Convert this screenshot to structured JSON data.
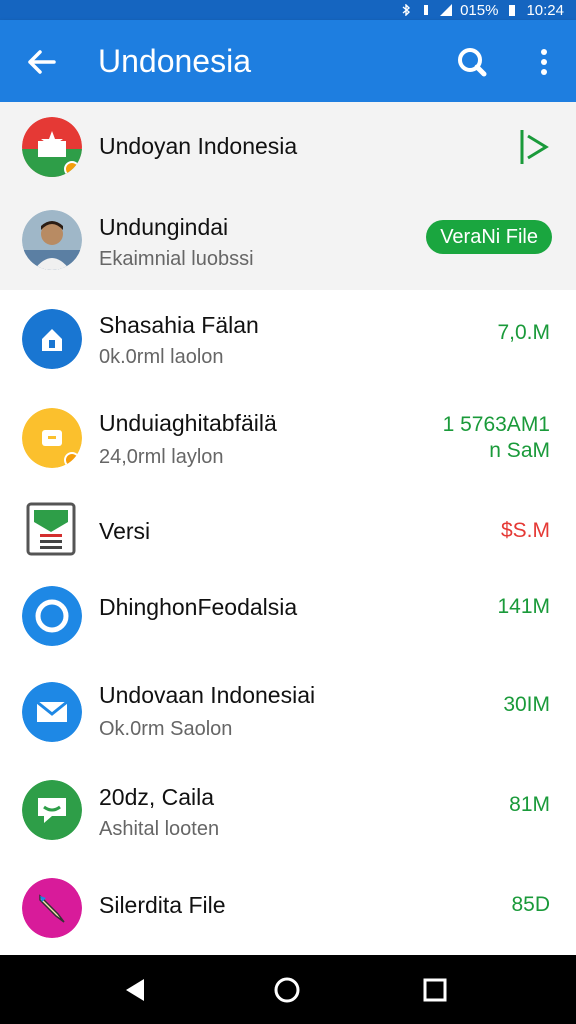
{
  "status": {
    "battery": "015%",
    "time": "10:24"
  },
  "appbar": {
    "title": "Undonesia"
  },
  "items": [
    {
      "title": "Undoyan Indonesia",
      "subtitle": "",
      "meta": "",
      "meta2": "",
      "badge": "",
      "meta_color": "#1a9a3a",
      "action_icon": "login-arrow-icon"
    },
    {
      "title": "Undungindai",
      "subtitle": "Ekaimnial luobssi",
      "meta": "",
      "meta2": "",
      "badge": "VeraNi File",
      "meta_color": "#1a9a3a"
    },
    {
      "title": "Shasahia Fälan",
      "subtitle": "0k.0rml laolon",
      "meta": "7,0.M",
      "meta2": "",
      "badge": "",
      "meta_color": "#1a9a3a"
    },
    {
      "title": "Unduiaghitabfäilä",
      "subtitle": "24,0rml laylon",
      "meta": "1 5763AM1",
      "meta2": "n SaM",
      "badge": "",
      "meta_color": "#1a9a3a"
    },
    {
      "title": "Versi",
      "subtitle": "",
      "meta": "$S.M",
      "meta2": "",
      "badge": "",
      "meta_color": "#e53935"
    },
    {
      "title": "DhinghonFeodalsia",
      "subtitle": "",
      "meta": "141M",
      "meta2": "",
      "badge": "",
      "meta_color": "#1a9a3a"
    },
    {
      "title": "Undovaan Indonesiai",
      "subtitle": "Ok.0rm Saolon",
      "meta": "30IM",
      "meta2": "",
      "badge": "",
      "meta_color": "#1a9a3a"
    },
    {
      "title": "20dz, Caila",
      "subtitle": "Ashital looten",
      "meta": "81M",
      "meta2": "",
      "badge": "",
      "meta_color": "#1a9a3a"
    },
    {
      "title": "Silerdita File",
      "subtitle": "",
      "meta": "85D",
      "meta2": "",
      "badge": "",
      "meta_color": "#1a9a3a"
    }
  ],
  "icons": {
    "back": "arrow-left-icon",
    "search": "search-icon",
    "more": "more-vertical-icon",
    "nav_back": "triangle-back-icon",
    "nav_home": "circle-home-icon",
    "nav_recents": "square-recents-icon"
  },
  "colors": {
    "appbar": "#1e7ee0",
    "statusbar": "#1565c0",
    "accent_green": "#1aa63f",
    "meta_red": "#e53935"
  }
}
